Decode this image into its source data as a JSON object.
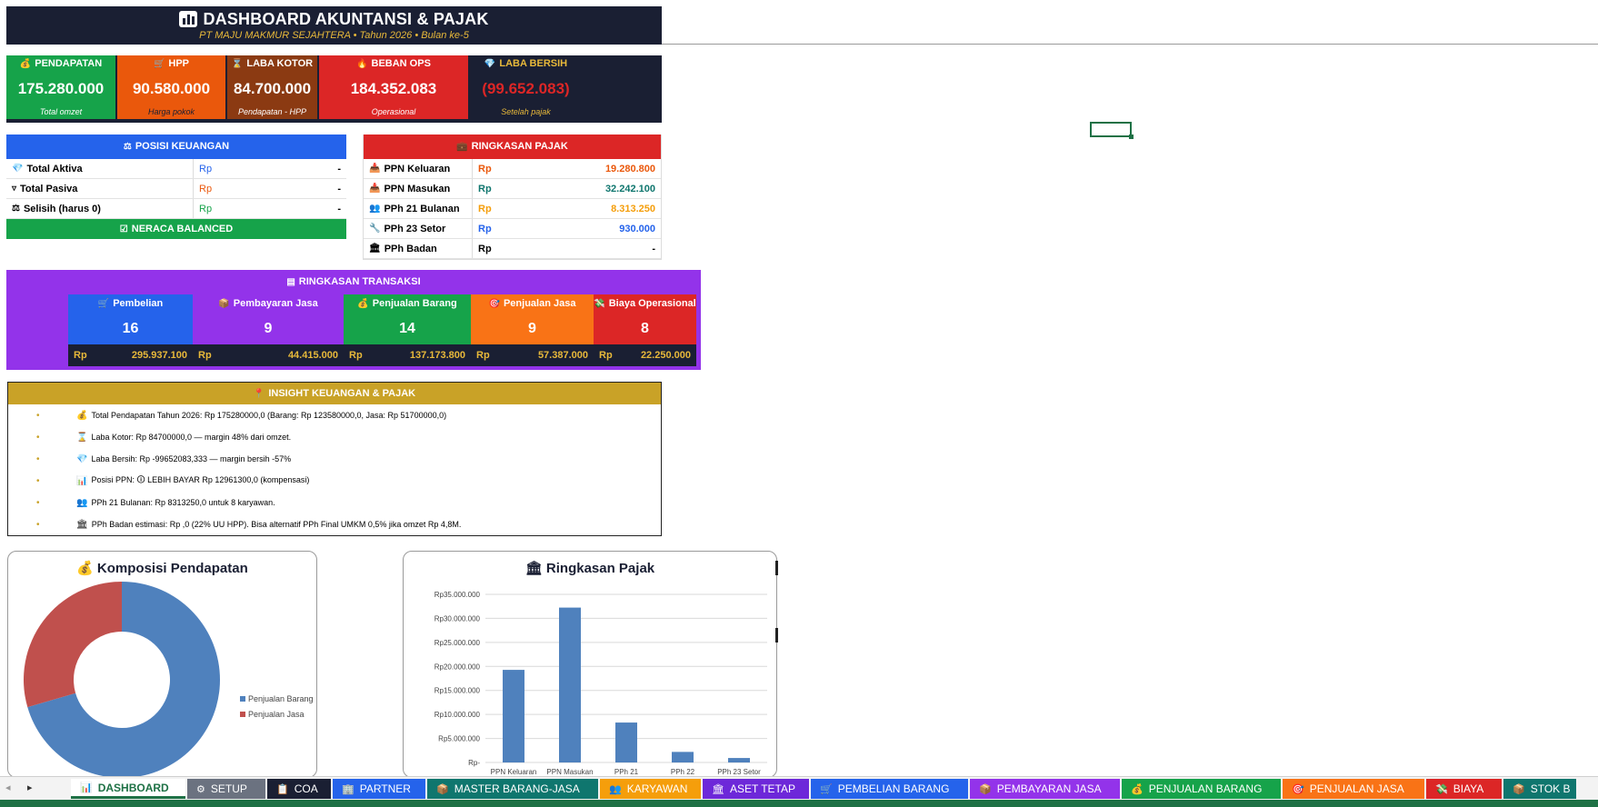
{
  "header": {
    "title_icon": "chart-icon",
    "title": "DASHBOARD AKUNTANSI & PAJAK",
    "subtitle": "PT MAJU MAKMUR SEJAHTERA • Tahun 2026 • Bulan ke-5"
  },
  "kpis": [
    {
      "icon": "money-bag-icon",
      "label": "PENDAPATAN",
      "value": "175.280.000",
      "note": "Total omzet",
      "color": "#16a34a",
      "value_color": "#ffffff",
      "note_color": "#ffffff"
    },
    {
      "icon": "cart-icon",
      "label": "HPP",
      "value": "90.580.000",
      "note": "Harga pokok",
      "color": "#ea580c",
      "value_color": "#ffffff",
      "note_color": "#1a1f33"
    },
    {
      "icon": "hourglass-icon",
      "label": "LABA KOTOR",
      "value": "84.700.000",
      "note": "Pendapatan - HPP",
      "color": "#8b3a12",
      "value_color": "#ffffff",
      "note_color": "#ffffff"
    },
    {
      "icon": "flame-icon",
      "label": "BEBAN OPS",
      "value": "184.352.083",
      "note": "Operasional",
      "color": "#dc2626",
      "value_color": "#ffffff",
      "note_color": "#ffffff"
    },
    {
      "icon": "gem-icon",
      "label": "LABA BERSIH",
      "value": "(99.652.083)",
      "note": "Setelah pajak",
      "color": "#1a1f33",
      "value_color": "#dc2626",
      "note_color": "#e8b93a"
    }
  ],
  "posisi": {
    "title": "POSISI KEUANGAN",
    "rows": [
      {
        "icon": "gem-icon",
        "label": "Total Aktiva",
        "cur": "Rp",
        "value": "-",
        "cur_color": "#2563eb"
      },
      {
        "icon": "filter-icon",
        "label": "Total Pasiva",
        "cur": "Rp",
        "value": "-",
        "cur_color": "#ea580c"
      },
      {
        "icon": "scale-icon",
        "label": "Selisih (harus 0)",
        "cur": "Rp",
        "value": "-",
        "cur_color": "#16a34a"
      }
    ],
    "status": "NERACA BALANCED"
  },
  "pajak": {
    "title": "RINGKASAN PAJAK",
    "rows": [
      {
        "icon": "inbox-icon",
        "label": "PPN Keluaran",
        "cur": "Rp",
        "value": "19.280.800",
        "color": "#ea580c"
      },
      {
        "icon": "inbox-icon",
        "label": "PPN Masukan",
        "cur": "Rp",
        "value": "32.242.100",
        "color": "#0f766e"
      },
      {
        "icon": "people-icon",
        "label": "PPh 21 Bulanan",
        "cur": "Rp",
        "value": "8.313.250",
        "color": "#f59e0b"
      },
      {
        "icon": "wrench-icon",
        "label": "PPh 23 Setor",
        "cur": "Rp",
        "value": "930.000",
        "color": "#2563eb"
      },
      {
        "icon": "bank-icon",
        "label": "PPh Badan",
        "cur": "Rp",
        "value": "-",
        "color": "#000000"
      }
    ]
  },
  "transaksi": {
    "title": "RINGKASAN TRANSAKSI",
    "cards": [
      {
        "icon": "cart-icon",
        "label": "Pembelian",
        "count": "16",
        "cur": "Rp",
        "amount": "295.937.100",
        "color": "#2563eb"
      },
      {
        "icon": "box-icon",
        "label": "Pembayaran Jasa",
        "count": "9",
        "cur": "Rp",
        "amount": "44.415.000",
        "color": "#9333ea"
      },
      {
        "icon": "money-bag-icon",
        "label": "Penjualan Barang",
        "count": "14",
        "cur": "Rp",
        "amount": "137.173.800",
        "color": "#16a34a"
      },
      {
        "icon": "target-icon",
        "label": "Penjualan Jasa",
        "count": "9",
        "cur": "Rp",
        "amount": "57.387.000",
        "color": "#f97316"
      },
      {
        "icon": "money-flying-icon",
        "label": "Biaya Operasional",
        "count": "8",
        "cur": "Rp",
        "amount": "22.250.000",
        "color": "#dc2626"
      }
    ]
  },
  "insight": {
    "title": "INSIGHT KEUANGAN & PAJAK",
    "bullet": "•",
    "items": [
      {
        "icon": "money-bag-icon",
        "text": "Total Pendapatan Tahun 2026: Rp 175280000,0 (Barang: Rp 123580000,0, Jasa: Rp 51700000,0)"
      },
      {
        "icon": "hourglass-icon",
        "text": "Laba Kotor: Rp 84700000,0 — margin 48% dari omzet."
      },
      {
        "icon": "gem-icon",
        "text": "Laba Bersih: Rp -99652083,333 — margin bersih -57%"
      },
      {
        "icon": "chart-icon",
        "text": "Posisi PPN: 🛈 LEBIH BAYAR Rp 12961300,0 (kompensasi)"
      },
      {
        "icon": "people-icon",
        "text": "PPh 21 Bulanan: Rp 8313250,0 untuk 8 karyawan."
      },
      {
        "icon": "bank-icon",
        "text": "PPh Badan estimasi: Rp ,0 (22% UU HPP). Bisa alternatif PPh Final UMKM 0,5% jika omzet    Rp 4,8M."
      }
    ]
  },
  "pie_card": {
    "title_icon": "money-bag-icon",
    "title": "Komposisi Pendapatan"
  },
  "bar_card": {
    "title_icon": "bank-icon",
    "title": "Ringkasan Pajak"
  },
  "chart_data": [
    {
      "type": "pie",
      "title": "Komposisi Pendapatan",
      "categories": [
        "Penjualan Barang",
        "Penjualan Jasa"
      ],
      "values": [
        123580000,
        51700000
      ],
      "colors": [
        "#4f81bd",
        "#c0504d"
      ],
      "donut": true,
      "legend": "right"
    },
    {
      "type": "bar",
      "title": "Ringkasan Pajak",
      "categories": [
        "PPN Keluaran",
        "PPN Masukan",
        "PPh 21",
        "PPh 22",
        "PPh 23 Setor"
      ],
      "values": [
        19280800,
        32242100,
        8313250,
        2200000,
        930000
      ],
      "ylim": [
        0,
        35000000
      ],
      "yticks": [
        "Rp-",
        "Rp5.000.000",
        "Rp10.000.000",
        "Rp15.000.000",
        "Rp20.000.000",
        "Rp25.000.000",
        "Rp30.000.000",
        "Rp35.000.000"
      ],
      "grid": true,
      "color": "#4f81bd"
    }
  ],
  "tabs": [
    {
      "label": "DASHBOARD",
      "icon": "chart-icon",
      "color": "#1e7145",
      "active": true
    },
    {
      "label": "SETUP",
      "icon": "gear-icon",
      "color": "#6b7280"
    },
    {
      "label": "COA",
      "icon": "clipboard-icon",
      "color": "#1a1f33"
    },
    {
      "label": "PARTNER",
      "icon": "building-icon",
      "color": "#2563eb"
    },
    {
      "label": "MASTER BARANG-JASA",
      "icon": "box-icon",
      "color": "#0f766e"
    },
    {
      "label": "KARYAWAN",
      "icon": "people-icon",
      "color": "#f59e0b"
    },
    {
      "label": "ASET TETAP",
      "icon": "bank-icon",
      "color": "#6d28d9"
    },
    {
      "label": "PEMBELIAN BARANG",
      "icon": "cart-icon",
      "color": "#2563eb"
    },
    {
      "label": "PEMBAYARAN JASA",
      "icon": "box-icon",
      "color": "#9333ea"
    },
    {
      "label": "PENJUALAN BARANG",
      "icon": "money-bag-icon",
      "color": "#16a34a"
    },
    {
      "label": "PENJUALAN JASA",
      "icon": "target-icon",
      "color": "#f97316"
    },
    {
      "label": "BIAYA",
      "icon": "money-flying-icon",
      "color": "#dc2626"
    },
    {
      "label": "STOK B",
      "icon": "box-icon",
      "color": "#0f766e"
    }
  ]
}
